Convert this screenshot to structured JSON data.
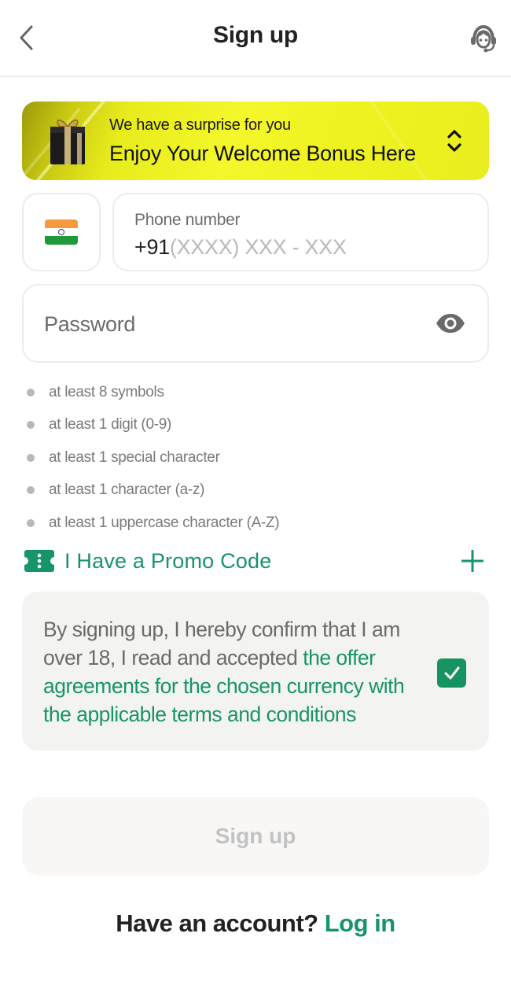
{
  "header": {
    "title": "Sign up",
    "back_icon": "chevron-left-icon",
    "support_icon": "support-agent-icon"
  },
  "bonus_banner": {
    "subtitle": "We have a surprise for you",
    "title": "Enjoy Your Welcome Bonus Here",
    "icon": "gift-icon",
    "toggle_icon": "chevron-up-down-icon",
    "background_color": "#eef21e"
  },
  "country": {
    "flag": "India",
    "flag_icon": "india-flag-icon"
  },
  "phone": {
    "label": "Phone number",
    "country_code": "+91",
    "placeholder": "(XXXX) XXX - XXX"
  },
  "password": {
    "placeholder": "Password",
    "toggle_icon": "eye-icon"
  },
  "password_rules": [
    "at least 8 symbols",
    "at least 1 digit (0-9)",
    "at least 1 special character",
    "at least 1 character (a-z)",
    "at least 1 uppercase character (A-Z)"
  ],
  "promo": {
    "label": "I Have a Promo Code",
    "icon": "ticket-icon",
    "expand_icon": "plus-icon"
  },
  "terms": {
    "text_plain": "By signing up, I hereby confirm that I am over 18, I read and accepted ",
    "text_link": "the offer agreements for the chosen currency with the applicable terms and conditions",
    "checked": true
  },
  "signup_button": {
    "label": "Sign up",
    "enabled": false
  },
  "login": {
    "prompt": "Have an account?",
    "link": "Log in"
  },
  "colors": {
    "accent": "#18946a",
    "checkbox": "#17935f",
    "disabled_text": "#c2c2c2",
    "muted_text": "#7a7a7a"
  }
}
